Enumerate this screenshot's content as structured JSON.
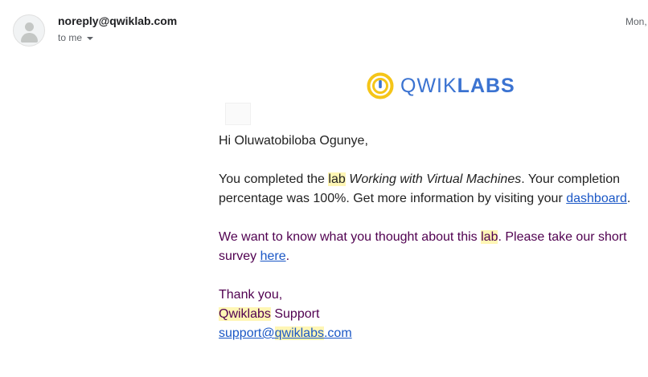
{
  "email": {
    "sender": "noreply@qwiklab.com",
    "recipient_label": "to me",
    "date": "Mon,"
  },
  "logo": {
    "text_light": "QWIK",
    "text_bold": "LABS",
    "icon": "qwiklabs-logo-icon",
    "colors": {
      "ring": "#f5c518",
      "text": "#3b73d1"
    }
  },
  "message": {
    "greeting": "Hi Oluwatobiloba Ogunye,",
    "p1_a": "You completed the ",
    "p1_lab": "lab",
    "p1_title": "Working with Virtual Machines",
    "p1_b": ". Your completion percentage was 100%. Get more information by visiting your ",
    "p1_link": "dashboard",
    "p1_end": ".",
    "p2_a": "We want to know what you thought about this ",
    "p2_lab": "lab",
    "p2_b": ". Please take our short survey ",
    "p2_link": "here",
    "p2_end": ".",
    "thanks": "Thank you,",
    "sig_brand": "Qwiklabs",
    "sig_rest": " Support",
    "email_a": "support@",
    "email_b": "qwiklabs",
    "email_c": ".com"
  },
  "colors": {
    "highlight": "#fff6b5",
    "link": "#1a57c6",
    "quoted_text": "#500050"
  }
}
